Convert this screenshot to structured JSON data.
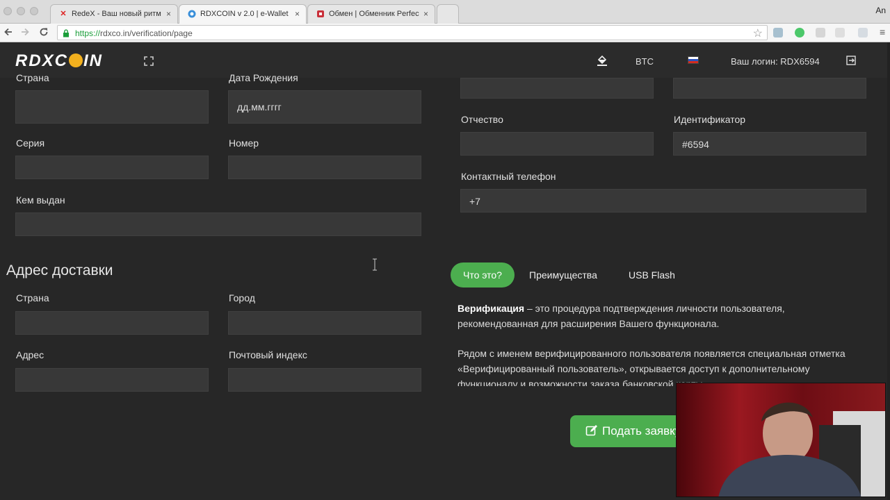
{
  "browser": {
    "tabs": [
      {
        "title": "RedeX - Ваш новый ритм",
        "icon": "redex-x-icon"
      },
      {
        "title": "RDXCOIN v 2.0 | e-Wallet",
        "icon": "rdxcoin-icon"
      },
      {
        "title": "Обмен | Обменник Perfec",
        "icon": "exchange-icon"
      }
    ],
    "corner_label": "An",
    "url_scheme": "https://",
    "url_rest": "rdxco.in/verification/page"
  },
  "header": {
    "logo_left": "RDXC",
    "logo_right": "IN",
    "currency": "BTC",
    "login_label": "Ваш логин: RDX6594"
  },
  "passport": {
    "country_label": "Страна",
    "birthdate_label": "Дата Рождения",
    "birthdate_value": "дд.мм.гггг",
    "series_label": "Серия",
    "number_label": "Номер",
    "issued_by_label": "Кем выдан"
  },
  "personal": {
    "patronymic_label": "Отчество",
    "id_label": "Идентификатор",
    "id_value": "#6594",
    "phone_label": "Контактный телефон",
    "phone_value": "+7"
  },
  "delivery": {
    "title": "Адрес доставки",
    "country_label": "Страна",
    "city_label": "Город",
    "address_label": "Адрес",
    "zip_label": "Почтовый индекс"
  },
  "info_tabs": [
    {
      "label": "Что это?",
      "active": true
    },
    {
      "label": "Преимущества",
      "active": false
    },
    {
      "label": "USB Flash",
      "active": false
    }
  ],
  "info": {
    "p1_strong": "Верификация",
    "p1_rest": " – это процедура подтверждения личности пользователя, рекомендованная для расширения Вашего функционала.",
    "p2": "Рядом с именем верифицированного пользователя появляется специальная отметка «Верифицированный пользователь», открывается доступ к дополнительному функционалу и возможности заказа банковской карты."
  },
  "submit_label": "Подать заявку",
  "colors": {
    "accent": "#4cae4f",
    "background": "#272727",
    "field": "#383838",
    "coin": "#f2b01e"
  }
}
